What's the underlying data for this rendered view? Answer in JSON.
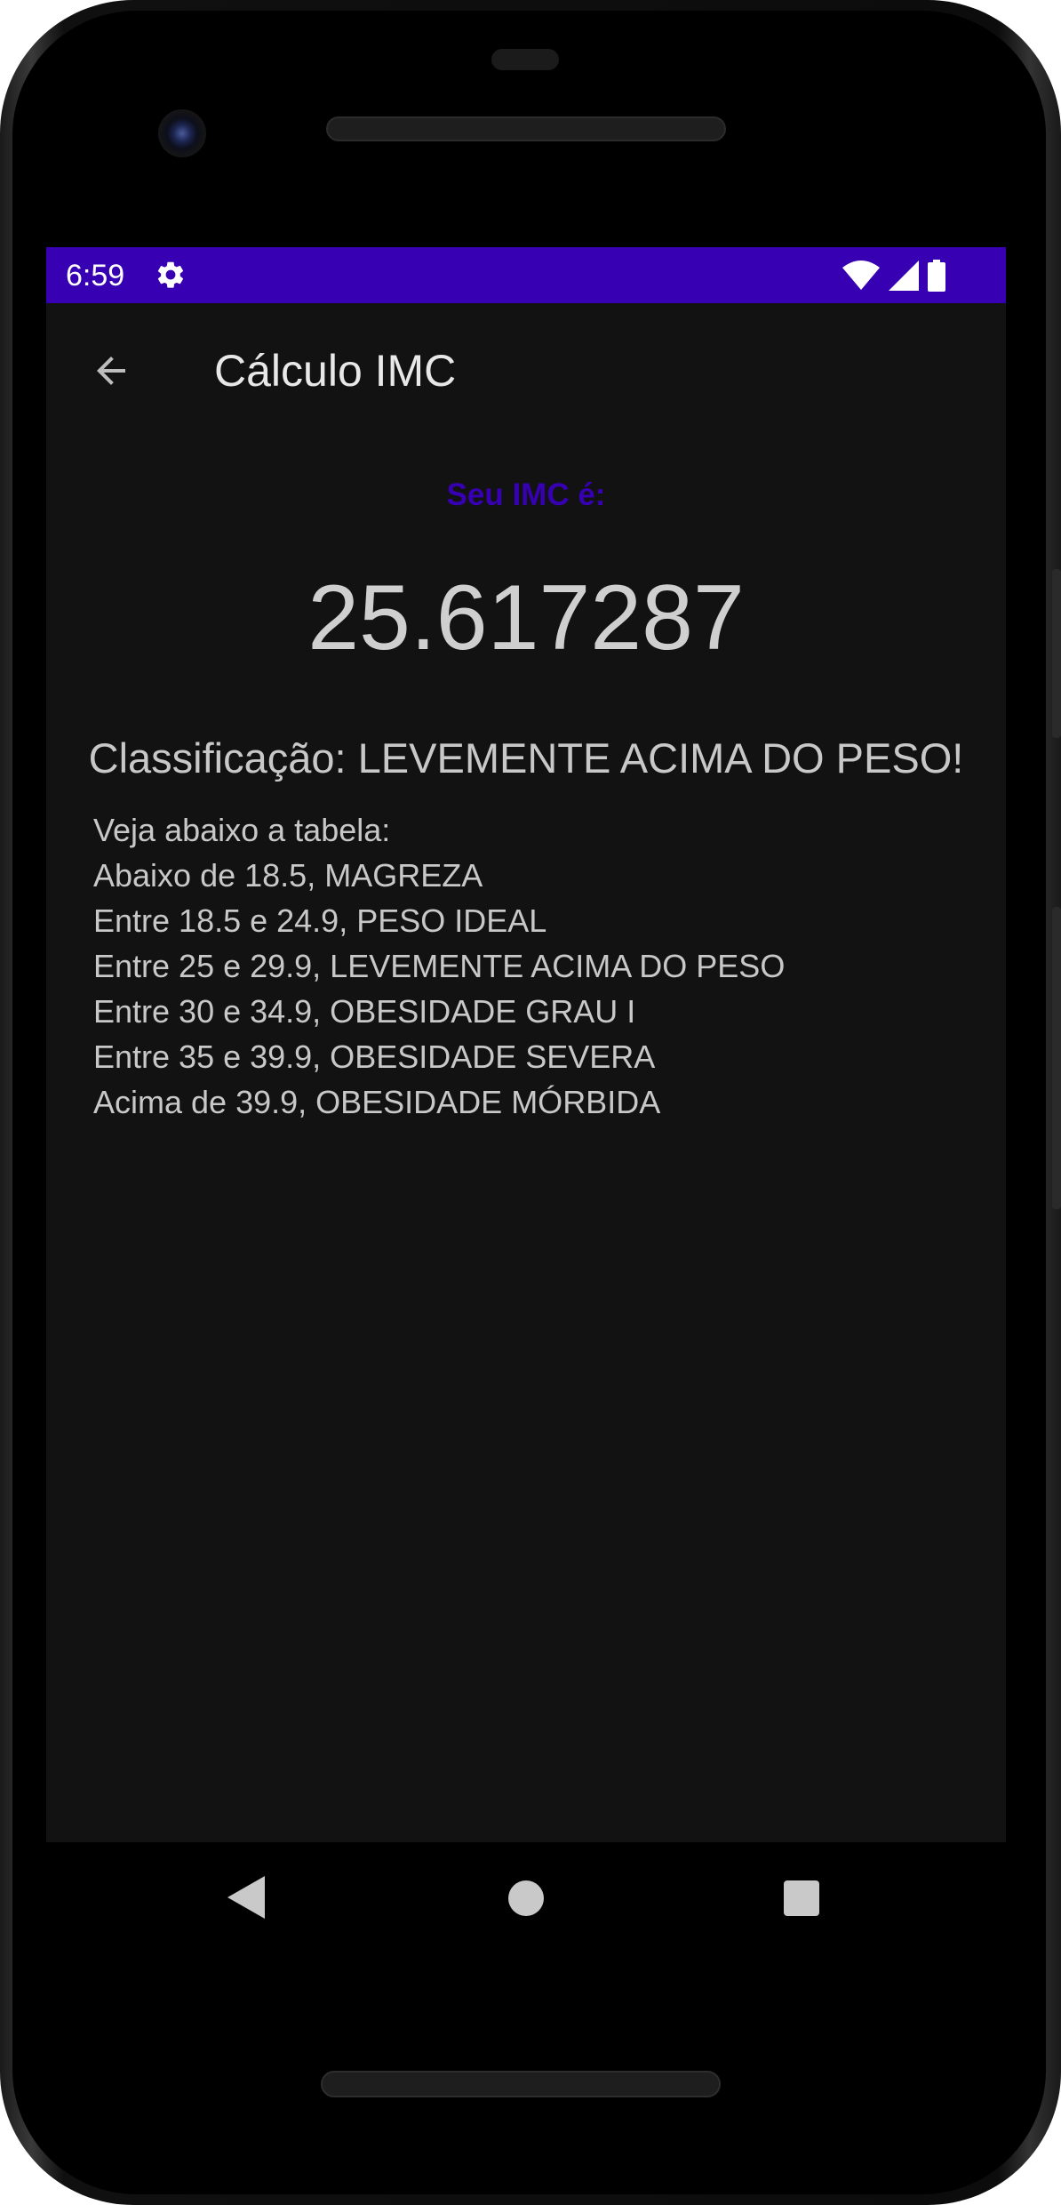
{
  "status_bar": {
    "time": "6:59",
    "color": "#3700b3",
    "icons": [
      "settings-gear-icon",
      "wifi-icon",
      "cell-signal-icon",
      "battery-icon"
    ]
  },
  "app_bar": {
    "title": "Cálculo IMC",
    "back_icon": "arrow-back-icon"
  },
  "result": {
    "label": "Seu IMC é:",
    "label_color": "#3700b3",
    "value": "25.617287",
    "classification": "Classificação: LEVEMENTE ACIMA DO PESO!"
  },
  "table": {
    "lines": [
      "Veja abaixo a tabela:",
      "Abaixo de 18.5, MAGREZA",
      "Entre 18.5 e 24.9, PESO IDEAL",
      "Entre 25 e 29.9, LEVEMENTE ACIMA DO PESO",
      "Entre 30 e 34.9, OBESIDADE GRAU I",
      "Entre 35 e 39.9, OBESIDADE SEVERA",
      "Acima de 39.9, OBESIDADE MÓRBIDA"
    ]
  },
  "navigation": {
    "icons": [
      "nav-back-icon",
      "nav-home-icon",
      "nav-recents-icon"
    ]
  },
  "colors": {
    "background": "#121212",
    "text": "#c8c8c8",
    "accent": "#3700b3"
  }
}
